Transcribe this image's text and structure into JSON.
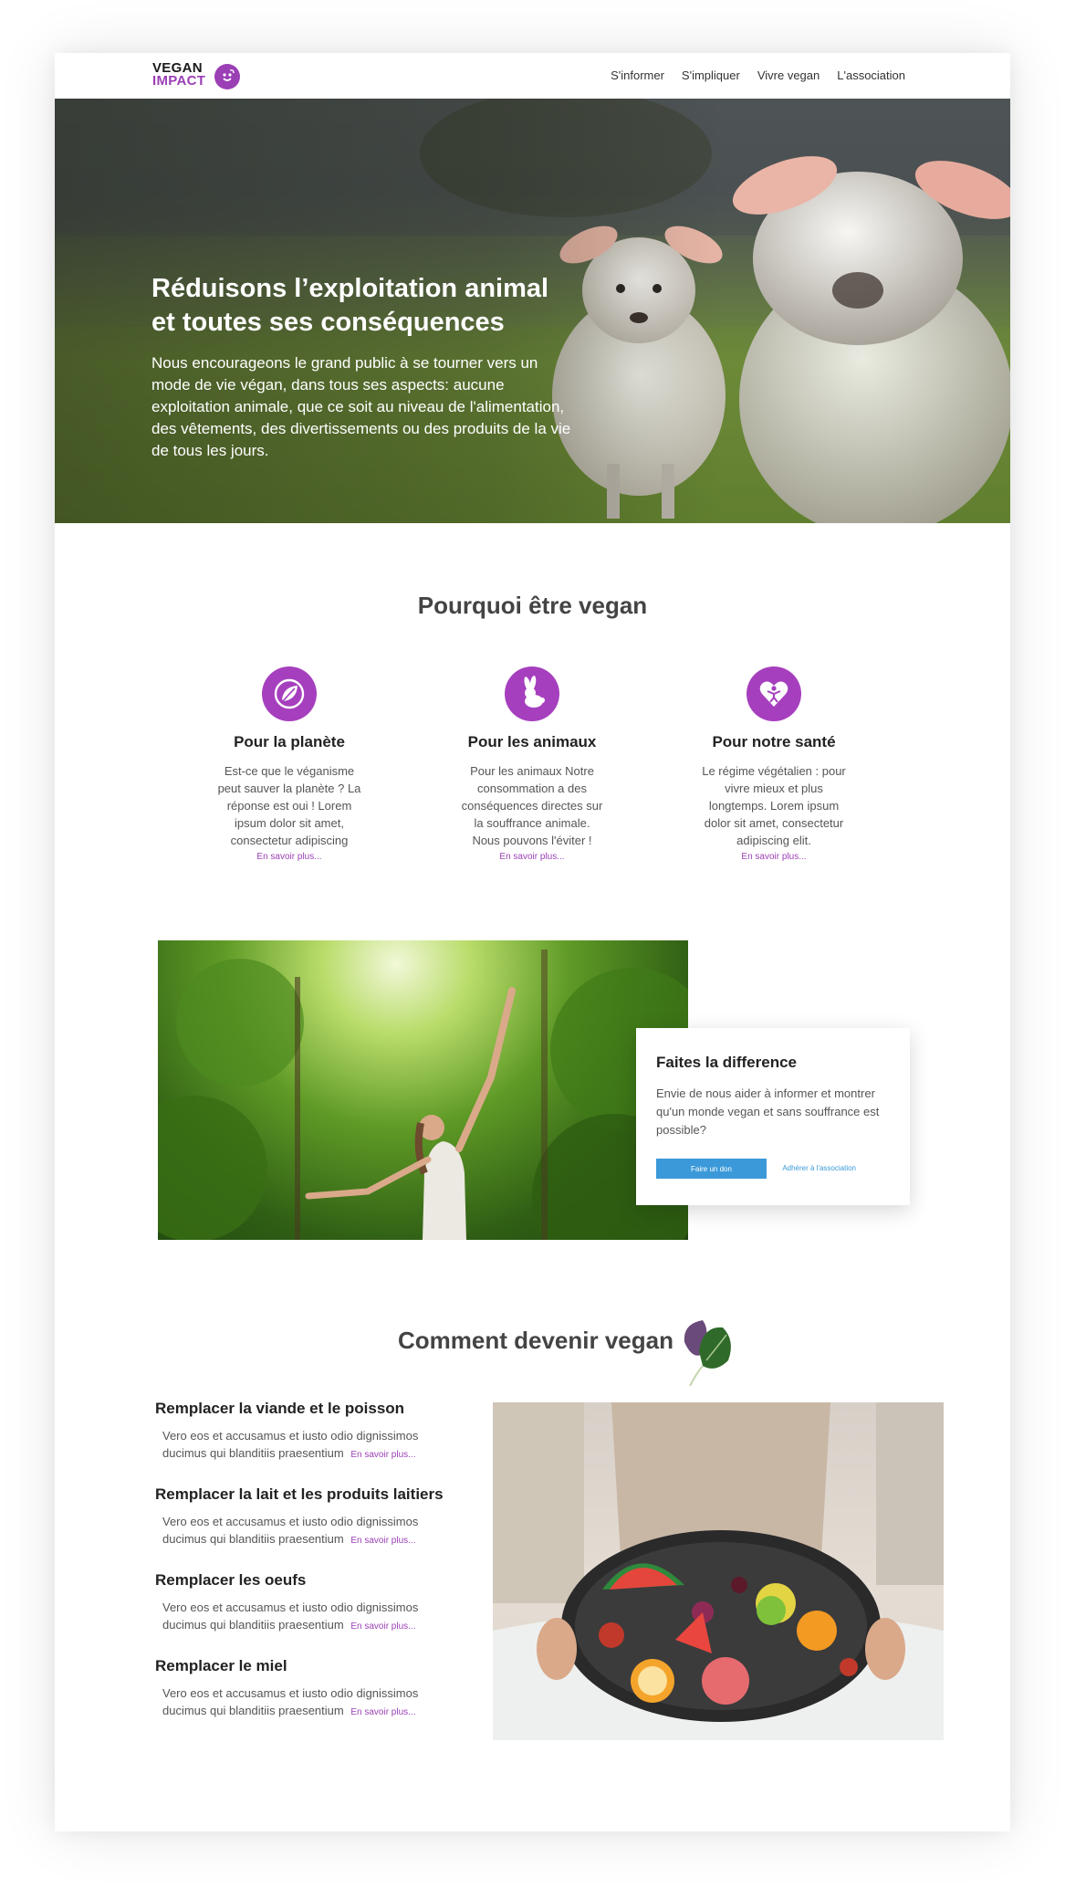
{
  "header": {
    "logo": {
      "line1": "VEGAN",
      "line2": "IMPACT"
    },
    "nav": [
      "S'informer",
      "S'impliquer",
      "Vivre vegan",
      "L'association"
    ]
  },
  "hero": {
    "title": "Réduisons l’exploitation animal et toutes ses conséquences",
    "text": "Nous encourageons le grand public à se tourner vers un mode de vie végan, dans tous ses aspects: aucune exploitation animale, que ce soit au niveau de l'alimentation, des vêtements, des divertissements ou des produits de la vie de tous les jours."
  },
  "why": {
    "title": "Pourquoi être vegan",
    "features": [
      {
        "icon": "leaf-globe-icon",
        "title": "Pour la planète",
        "text": "Est-ce que le véganisme peut sauver la planète ? La réponse est oui ! Lorem ipsum dolor sit amet, consectetur adipiscing",
        "link": "En savoir plus..."
      },
      {
        "icon": "rabbit-icon",
        "title": "Pour les animaux",
        "text": "Pour les animaux Notre consommation a des conséquences directes sur la souffrance animale. Nous pouvons l'éviter !",
        "link": "En savoir plus..."
      },
      {
        "icon": "heart-person-icon",
        "title": "Pour notre santé",
        "text": "Le régime végétalien : pour vivre mieux et plus longtemps. Lorem ipsum dolor sit amet, consectetur adipiscing elit.",
        "link": "En savoir plus..."
      }
    ]
  },
  "difference": {
    "title": "Faites la difference",
    "text": "Envie de nous aider à informer et montrer qu'un monde vegan et sans souffrance est possible?",
    "donate_label": "Faire un don",
    "join_label": "Adhérer à l'association"
  },
  "how": {
    "title": "Comment devenir vegan",
    "steps": [
      {
        "title": "Remplacer la viande et le poisson",
        "text": "Vero eos et accusamus et iusto odio dignissimos ducimus qui blanditiis praesentium",
        "link": "En savoir plus..."
      },
      {
        "title": "Remplacer la lait et les produits laitiers",
        "text": "Vero eos et accusamus et iusto odio dignissimos ducimus qui blanditiis praesentium",
        "link": "En savoir plus..."
      },
      {
        "title": "Remplacer les oeufs",
        "text": "Vero eos et accusamus et iusto odio dignissimos ducimus qui blanditiis praesentium",
        "link": "En savoir plus..."
      },
      {
        "title": "Remplacer le miel",
        "text": "Vero eos et accusamus et iusto odio dignissimos ducimus qui blanditiis praesentium",
        "link": "En savoir plus..."
      }
    ]
  },
  "colors": {
    "brand_purple": "#9b3fb5",
    "icon_purple": "#a63fbe",
    "button_blue": "#3b99d9"
  }
}
